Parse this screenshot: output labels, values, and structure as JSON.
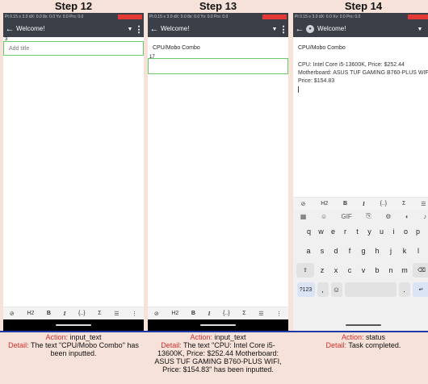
{
  "steps": [
    {
      "title": "Step 12",
      "status": "Pt 0.15 ≡ 3.0 dX: 0.0 8x: 0.0 Yv: 0.0 Prs: 0.0",
      "appbar_title": "Welcome!",
      "note_title_placeholder": "Add title",
      "title_tag": "3",
      "toolbar": [
        "⊘",
        "H2",
        "B",
        "I",
        "{..}",
        "Σ",
        "☰",
        "⋮"
      ],
      "action_label": "Action:",
      "action": "input_text",
      "detail_label": "Detail:",
      "detail": "The text \"CPU/Mobo Combo\" has been inputted."
    },
    {
      "title": "Step 13",
      "status": "Pt 0.15 ≡ 3.0 dX: 0.0 8x: 0.0 Yv: 0.0 Prs: 0.0",
      "appbar_title": "Welcome!",
      "note_title": "CPU/Mobo Combo",
      "body_tag": "17",
      "toolbar": [
        "⊘",
        "H2",
        "B",
        "I",
        "{..}",
        "Σ",
        "☰",
        "⋮"
      ],
      "action_label": "Action:",
      "action": "input_text",
      "detail_label": "Detail:",
      "detail": "The text \"CPU: Intel Core i5-13600K, Price: $252.44 Motherboard: ASUS TUF GAMING B760-PLUS WIFI, Price: $154.83\" has been inputted."
    },
    {
      "title": "Step 14",
      "status": "Pt 0.15 ≡ 3.0 dX: 0.0 Xv: 0.0 Prs: 0.0",
      "appbar_title": "Welcome!",
      "note_title": "CPU/Mobo Combo",
      "note_body": "CPU: Intel Core i5-13600K, Price: $252.44 Motherboard: ASUS TUF GAMING B760-PLUS WIFI, Price: $154.83",
      "toolbar": [
        "⊘",
        "H2",
        "B",
        "I",
        "{..}",
        "Σ",
        "☰"
      ],
      "keyboard": {
        "tools": [
          "▦",
          "☺",
          "GIF",
          "⎘",
          "⚙",
          "◐",
          "♪"
        ],
        "row1": [
          "q",
          "w",
          "e",
          "r",
          "t",
          "y",
          "u",
          "i",
          "o",
          "p"
        ],
        "row2": [
          "a",
          "s",
          "d",
          "f",
          "g",
          "h",
          "j",
          "k",
          "l"
        ],
        "row3": [
          "⇧",
          "z",
          "x",
          "c",
          "v",
          "b",
          "n",
          "m",
          "⌫"
        ],
        "row4": [
          "?123",
          ",",
          "☺",
          "",
          ".",
          "↵"
        ]
      },
      "action_label": "Action:",
      "action": "status",
      "detail_label": "Detail:",
      "detail": "Task completed."
    }
  ]
}
